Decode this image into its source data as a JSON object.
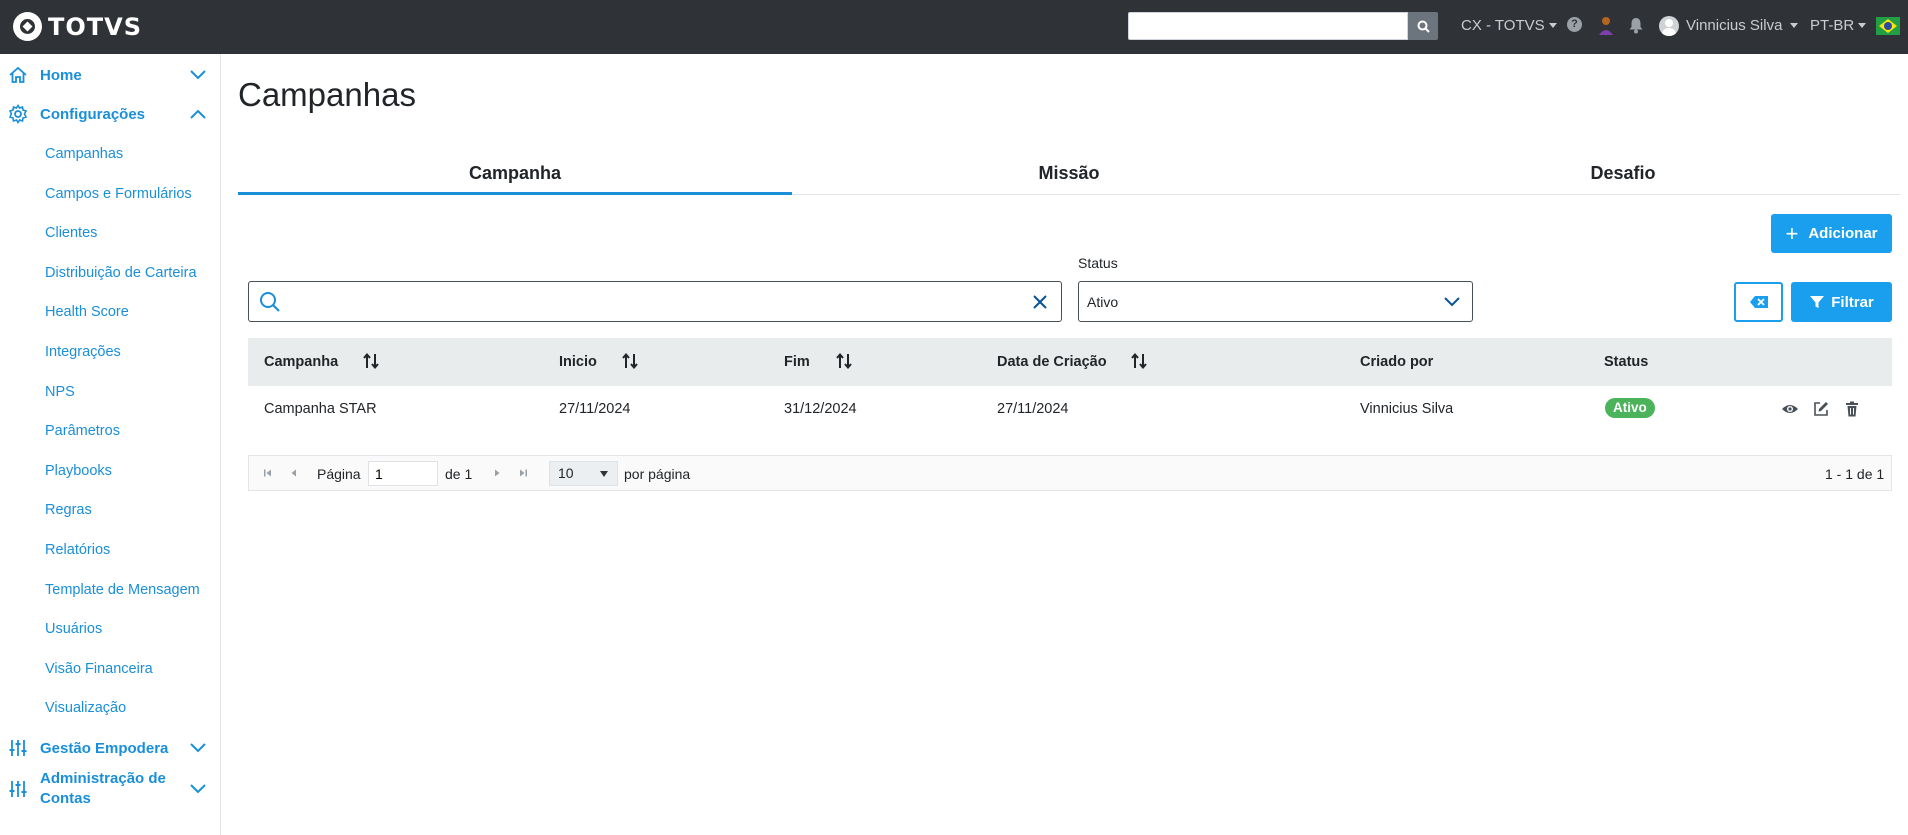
{
  "header": {
    "logo_text": "TOTVS",
    "search_placeholder": "",
    "workspace": "CX - TOTVS",
    "user_name": "Vinnicius Silva",
    "language": "PT-BR"
  },
  "sidebar": {
    "home_label": "Home",
    "config_label": "Configurações",
    "config_items": [
      "Campanhas",
      "Campos e Formulários",
      "Clientes",
      "Distribuição de Carteira",
      "Health Score",
      "Integrações",
      "NPS",
      "Parâmetros",
      "Playbooks",
      "Regras",
      "Relatórios",
      "Template de Mensagem",
      "Usuários",
      "Visão Financeira",
      "Visualização"
    ],
    "gestao_label": "Gestão Empodera",
    "admin_label_line1": "Administração de",
    "admin_label_line2": "Contas"
  },
  "page": {
    "title": "Campanhas",
    "tabs": [
      "Campanha",
      "Missão",
      "Desafio"
    ],
    "add_button": "Adicionar",
    "status_label": "Status",
    "status_value": "Ativo",
    "filter_button": "Filtrar"
  },
  "table": {
    "headers": [
      "Campanha",
      "Inicio",
      "Fim",
      "Data de Criação",
      "Criado por",
      "Status"
    ],
    "rows": [
      {
        "campanha": "Campanha STAR",
        "inicio": "27/11/2024",
        "fim": "31/12/2024",
        "data_criacao": "27/11/2024",
        "criado_por": "Vinnicius Silva",
        "status": "Ativo"
      }
    ]
  },
  "pager": {
    "page_label": "Página",
    "page_value": "1",
    "of_label": "de 1",
    "page_size": "10",
    "per_page_label": "por página",
    "range": "1 - 1 de 1"
  }
}
